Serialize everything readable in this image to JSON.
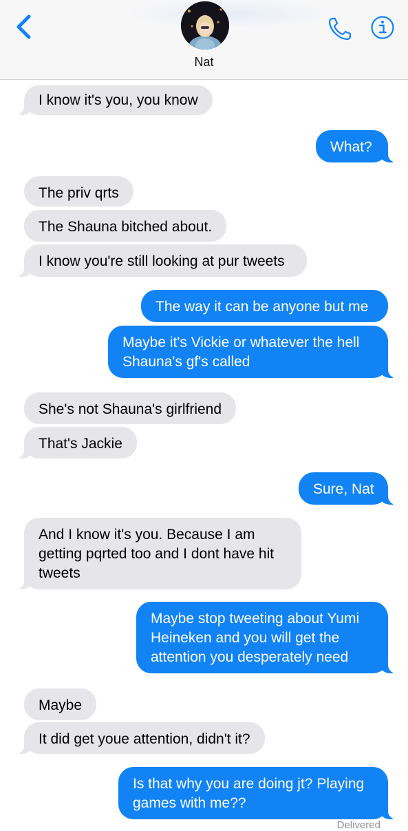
{
  "header": {
    "contact_name": "Nat",
    "back_icon": "chevron-left-icon",
    "call_icon": "phone-icon",
    "info_icon": "info-icon",
    "accent_color": "#1183f5"
  },
  "messages": [
    {
      "sender": "them",
      "text": "I know it's you, you know"
    },
    {
      "sender": "me",
      "text": "What?"
    },
    {
      "sender": "them",
      "text": "The priv qrts"
    },
    {
      "sender": "them",
      "text": "The Shauna bitched about."
    },
    {
      "sender": "them",
      "text": "I know you're still looking at pur tweets"
    },
    {
      "sender": "me",
      "text": "The way it can be anyone but me"
    },
    {
      "sender": "me",
      "text": "Maybe it's Vickie or whatever the hell Shauna's gf's called"
    },
    {
      "sender": "them",
      "text": "She's not Shauna's girlfriend"
    },
    {
      "sender": "them",
      "text": "That's Jackie"
    },
    {
      "sender": "me",
      "text": "Sure, Nat"
    },
    {
      "sender": "them",
      "text": "And I know it's you. Because I am getting pqrted too and I dont have hit tweets"
    },
    {
      "sender": "me",
      "text": "Maybe stop tweeting about Yumi Heineken and you will get the attention you desperately need"
    },
    {
      "sender": "them",
      "text": "Maybe"
    },
    {
      "sender": "them",
      "text": "It did get youe attention, didn't it?"
    },
    {
      "sender": "me",
      "text": "Is that why you are doing jt? Playing games with me??"
    }
  ],
  "status": {
    "delivered_label": "Delivered"
  },
  "colors": {
    "sent_bubble": "#1183f5",
    "received_bubble": "#e5e5ea",
    "header_bg": "#f7f7f8"
  }
}
